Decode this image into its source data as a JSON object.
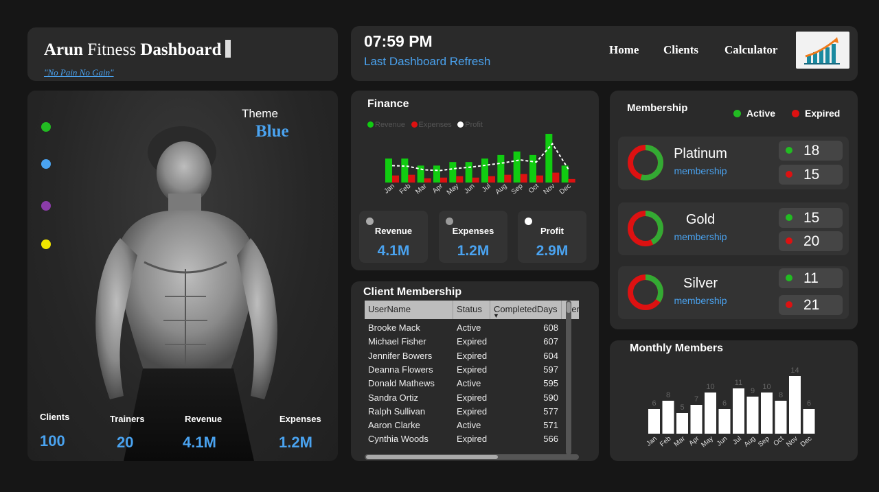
{
  "header": {
    "title_part1": "Arun",
    "title_part2": "Fitness",
    "title_part3": "Dashboard",
    "motto": "\"No Pain No Gain\"",
    "time": "07:59 PM",
    "refresh_label": "Last Dashboard Refresh",
    "nav": [
      "Home",
      "Clients",
      "Calculator"
    ]
  },
  "hero": {
    "theme_label": "Theme",
    "theme_value": "Blue",
    "theme_colors": [
      "#22bb22",
      "#4aa3f0",
      "#8b3ca8",
      "#f2e600"
    ],
    "stats": [
      {
        "label": "Clients",
        "value": "100"
      },
      {
        "label": "Trainers",
        "value": "20"
      },
      {
        "label": "Revenue",
        "value": "4.1M"
      },
      {
        "label": "Expenses",
        "value": "1.2M"
      }
    ]
  },
  "finance": {
    "title": "Finance",
    "legend": [
      "Revenue",
      "Expenses",
      "Profit"
    ],
    "colors": {
      "revenue": "#11cc11",
      "expenses": "#dd1111",
      "profit": "#ffffff"
    },
    "kpis": [
      {
        "label": "Revenue",
        "value": "4.1M"
      },
      {
        "label": "Expenses",
        "value": "1.2M"
      },
      {
        "label": "Profit",
        "value": "2.9M"
      }
    ]
  },
  "chart_data": [
    {
      "type": "bar",
      "title": "Finance",
      "categories": [
        "Jan",
        "Feb",
        "Mar",
        "Apr",
        "May",
        "Jun",
        "Jul",
        "Aug",
        "Sep",
        "Oct",
        "Nov",
        "Dec"
      ],
      "series": [
        {
          "name": "Revenue",
          "values": [
            340,
            340,
            240,
            240,
            290,
            290,
            340,
            390,
            440,
            390,
            690,
            240
          ]
        },
        {
          "name": "Expenses",
          "values": [
            100,
            110,
            60,
            70,
            90,
            70,
            90,
            110,
            120,
            100,
            140,
            50
          ]
        },
        {
          "name": "Profit",
          "values": [
            240,
            230,
            180,
            170,
            200,
            220,
            250,
            280,
            320,
            290,
            550,
            190
          ]
        }
      ]
    },
    {
      "type": "bar",
      "title": "Monthly Members",
      "categories": [
        "Jan",
        "Feb",
        "Mar",
        "Apr",
        "May",
        "Jun",
        "Jul",
        "Aug",
        "Sep",
        "Oct",
        "Nov",
        "Dec"
      ],
      "values": [
        6,
        8,
        5,
        7,
        10,
        6,
        11,
        9,
        10,
        8,
        14,
        6
      ]
    }
  ],
  "client_membership": {
    "title": "Client Membership",
    "columns": [
      "UserName",
      "Status",
      "CompletedDays",
      "Rer"
    ],
    "rows": [
      [
        "Brooke Mack",
        "Active",
        "608"
      ],
      [
        "Michael Fisher",
        "Expired",
        "607"
      ],
      [
        "Jennifer Bowers",
        "Expired",
        "604"
      ],
      [
        "Deanna Flowers",
        "Expired",
        "597"
      ],
      [
        "Donald Mathews",
        "Active",
        "595"
      ],
      [
        "Sandra Ortiz",
        "Expired",
        "590"
      ],
      [
        "Ralph Sullivan",
        "Expired",
        "577"
      ],
      [
        "Aaron Clarke",
        "Active",
        "571"
      ],
      [
        "Cynthia Woods",
        "Expired",
        "566"
      ]
    ]
  },
  "membership": {
    "title": "Membership",
    "legend": [
      {
        "label": "Active",
        "color": "#22bb22"
      },
      {
        "label": "Expired",
        "color": "#dd1111"
      }
    ],
    "tiers": [
      {
        "name": "Platinum",
        "sub": "membership",
        "active": "18",
        "expired": "15"
      },
      {
        "name": "Gold",
        "sub": "membership",
        "active": "15",
        "expired": "20"
      },
      {
        "name": "Silver",
        "sub": "membership",
        "active": "11",
        "expired": "21"
      }
    ]
  },
  "monthly_members": {
    "title": "Monthly Members"
  }
}
